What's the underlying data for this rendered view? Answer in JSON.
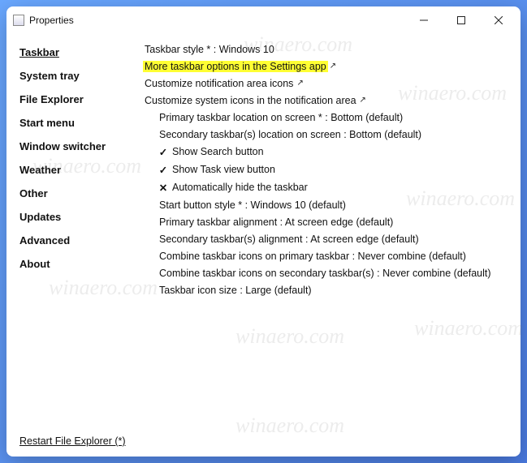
{
  "titlebar": {
    "title": "Properties"
  },
  "sidebar": {
    "items": [
      {
        "label": "Taskbar",
        "name": "sidebar-item-taskbar",
        "active": true
      },
      {
        "label": "System tray",
        "name": "sidebar-item-system-tray",
        "active": false
      },
      {
        "label": "File Explorer",
        "name": "sidebar-item-file-explorer",
        "active": false
      },
      {
        "label": "Start menu",
        "name": "sidebar-item-start-menu",
        "active": false
      },
      {
        "label": "Window switcher",
        "name": "sidebar-item-window-switcher",
        "active": false
      },
      {
        "label": "Weather",
        "name": "sidebar-item-weather",
        "active": false
      },
      {
        "label": "Other",
        "name": "sidebar-item-other",
        "active": false
      },
      {
        "label": "Updates",
        "name": "sidebar-item-updates",
        "active": false
      },
      {
        "label": "Advanced",
        "name": "sidebar-item-advanced",
        "active": false
      },
      {
        "label": "About",
        "name": "sidebar-item-about",
        "active": false
      }
    ]
  },
  "settings": [
    {
      "label": "Taskbar style * : Windows 10",
      "name": "setting-taskbar-style",
      "indent": 0,
      "mark": "",
      "ext": false,
      "highlight": false
    },
    {
      "label": "More taskbar options in the Settings app",
      "name": "setting-more-taskbar-options",
      "indent": 0,
      "mark": "",
      "ext": true,
      "highlight": true
    },
    {
      "label": "Customize notification area icons",
      "name": "setting-customize-notification-icons",
      "indent": 0,
      "mark": "",
      "ext": true,
      "highlight": false
    },
    {
      "label": "Customize system icons in the notification area",
      "name": "setting-customize-system-icons",
      "indent": 0,
      "mark": "",
      "ext": true,
      "highlight": false
    },
    {
      "label": "Primary taskbar location on screen * : Bottom (default)",
      "name": "setting-primary-taskbar-location",
      "indent": 1,
      "mark": "",
      "ext": false,
      "highlight": false
    },
    {
      "label": "Secondary taskbar(s) location on screen : Bottom (default)",
      "name": "setting-secondary-taskbar-location",
      "indent": 1,
      "mark": "",
      "ext": false,
      "highlight": false
    },
    {
      "label": "Show Search button",
      "name": "setting-show-search-button",
      "indent": 1,
      "mark": "✓",
      "ext": false,
      "highlight": false
    },
    {
      "label": "Show Task view button",
      "name": "setting-show-task-view-button",
      "indent": 1,
      "mark": "✓",
      "ext": false,
      "highlight": false
    },
    {
      "label": "Automatically hide the taskbar",
      "name": "setting-auto-hide-taskbar",
      "indent": 1,
      "mark": "✕",
      "ext": false,
      "highlight": false
    },
    {
      "label": "Start button style * : Windows 10 (default)",
      "name": "setting-start-button-style",
      "indent": 1,
      "mark": "",
      "ext": false,
      "highlight": false
    },
    {
      "label": "Primary taskbar alignment : At screen edge (default)",
      "name": "setting-primary-taskbar-alignment",
      "indent": 1,
      "mark": "",
      "ext": false,
      "highlight": false
    },
    {
      "label": "Secondary taskbar(s) alignment : At screen edge (default)",
      "name": "setting-secondary-taskbar-alignment",
      "indent": 1,
      "mark": "",
      "ext": false,
      "highlight": false
    },
    {
      "label": "Combine taskbar icons on primary taskbar : Never combine (default)",
      "name": "setting-combine-primary",
      "indent": 1,
      "mark": "",
      "ext": false,
      "highlight": false
    },
    {
      "label": "Combine taskbar icons on secondary taskbar(s) : Never combine (default)",
      "name": "setting-combine-secondary",
      "indent": 1,
      "mark": "",
      "ext": false,
      "highlight": false
    },
    {
      "label": "Taskbar icon size : Large (default)",
      "name": "setting-taskbar-icon-size",
      "indent": 1,
      "mark": "",
      "ext": false,
      "highlight": false
    }
  ],
  "footer": {
    "link": "Restart File Explorer (*)"
  },
  "watermark": "winaero.com"
}
